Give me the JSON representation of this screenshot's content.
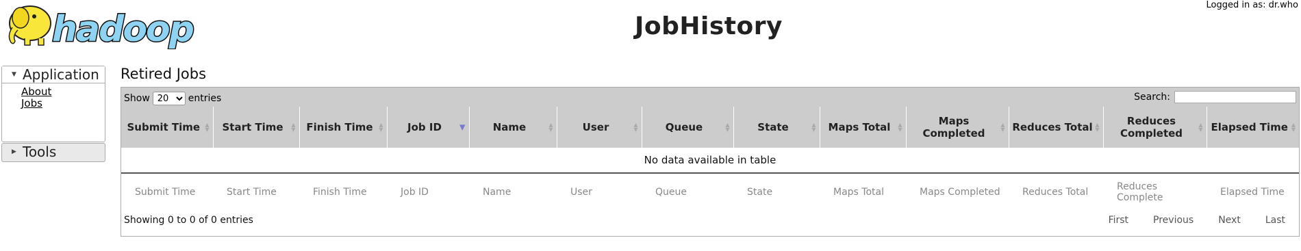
{
  "header": {
    "logo_text": "hadoop",
    "title": "JobHistory",
    "login": "Logged in as: dr.who"
  },
  "nav": {
    "application": {
      "label": "Application",
      "links": [
        "About",
        "Jobs"
      ]
    },
    "tools": {
      "label": "Tools"
    }
  },
  "main": {
    "section_title": "Retired Jobs",
    "length": {
      "show_label": "Show",
      "selected": "20",
      "entries_label": "entries"
    },
    "search_label": "Search:",
    "columns": [
      "Submit Time",
      "Start Time",
      "Finish Time",
      "Job ID",
      "Name",
      "User",
      "Queue",
      "State",
      "Maps Total",
      "Maps Completed",
      "Reduces Total",
      "Reduces Completed",
      "Elapsed Time"
    ],
    "footer_columns": [
      "Submit Time",
      "Start Time",
      "Finish Time",
      "Job ID",
      "Name",
      "User",
      "Queue",
      "State",
      "Maps Total",
      "Maps Completed",
      "Reduces Total",
      "Reduces Complete",
      "Elapsed Time"
    ],
    "empty_message": "No data available in table",
    "info": "Showing 0 to 0 of 0 entries",
    "pagination": [
      "First",
      "Previous",
      "Next",
      "Last"
    ]
  },
  "colors": {
    "toolbar_bg": "#cccccc",
    "logo_yellow": "#f8e63a",
    "logo_blue": "#8fd3f2"
  },
  "icons": [
    "hadoop-elephant-logo",
    "triangle-down-icon",
    "triangle-right-icon",
    "sort-icon"
  ]
}
